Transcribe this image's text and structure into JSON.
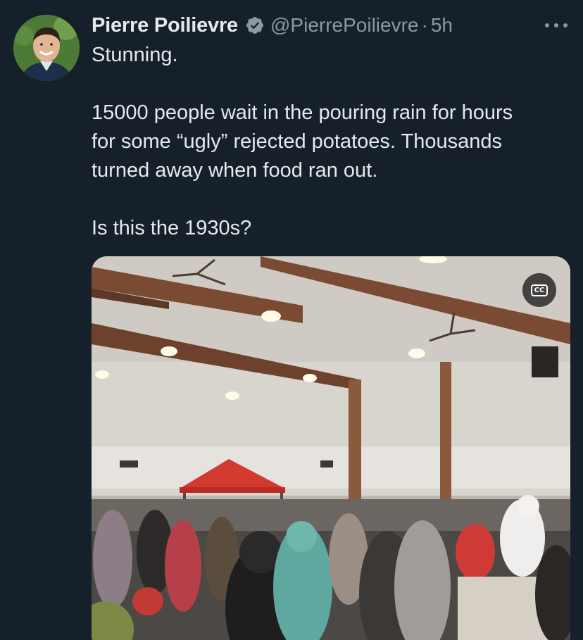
{
  "author": {
    "display_name": "Pierre Poilievre",
    "handle": "@PierrePoilievre",
    "verified": true,
    "time_sep": "·",
    "time_ago": "5h"
  },
  "tweet": {
    "paragraphs": [
      "Stunning.",
      "15000 people wait in the pouring rain for hours\nfor some “ugly” rejected potatoes. Thousands\nturned away when food ran out.",
      "Is this the 1930s?"
    ]
  },
  "media": {
    "caption_button_label": "CC"
  },
  "icons": {
    "verified": "verified-badge-icon",
    "more": "more-options-icon",
    "captions": "closed-captions-icon"
  },
  "colors": {
    "background": "#15202b",
    "text_primary": "#e7e9ea",
    "text_secondary": "#8b98a5",
    "verified_badge": "#8b98a5"
  }
}
